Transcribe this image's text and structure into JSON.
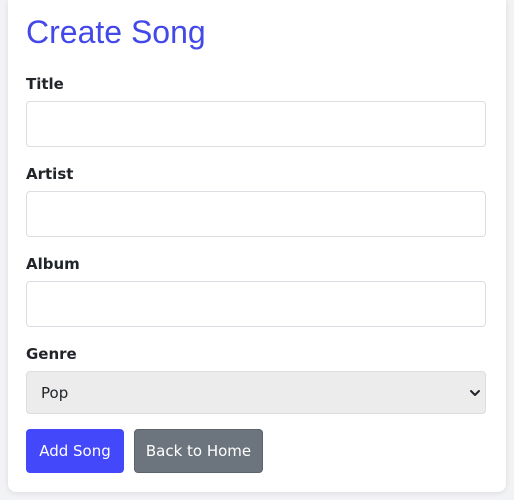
{
  "page": {
    "title": "Create Song"
  },
  "form": {
    "fields": [
      {
        "label": "Title",
        "value": "",
        "placeholder": ""
      },
      {
        "label": "Artist",
        "value": "",
        "placeholder": ""
      },
      {
        "label": "Album",
        "value": "",
        "placeholder": ""
      }
    ],
    "genre": {
      "label": "Genre",
      "selected": "Pop"
    }
  },
  "buttons": {
    "submit_label": "Add Song",
    "back_label": "Back to Home"
  },
  "colors": {
    "title": "#4348e8",
    "primary": "#4348fb",
    "secondary": "#6c757d"
  },
  "icons": {
    "select_arrow": "chevron-down-icon"
  }
}
